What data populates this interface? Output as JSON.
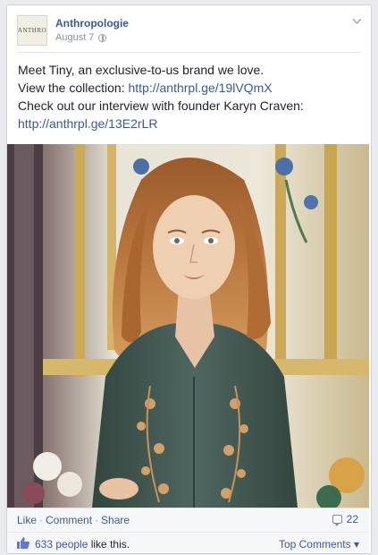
{
  "post": {
    "page_name": "Anthropologie",
    "avatar_text": "ANTHRO",
    "date": "August 7",
    "text_line_1": "Meet Tiny, an exclusive-to-us brand we love.",
    "text_line_2_prefix": "View the collection: ",
    "text_line_2_link": "http://anthrpl.ge/19lVQmX",
    "text_line_3": "Check out our interview with founder Karyn Craven:",
    "text_line_4_link": "http://anthrpl.ge/13E2rLR"
  },
  "actions": {
    "like": "Like",
    "comment": "Comment",
    "share": "Share",
    "separator": "·",
    "comment_count": "22"
  },
  "likes": {
    "count_text": "633 people",
    "suffix": " like this.",
    "top_comments": "Top Comments ▾"
  },
  "colors": {
    "link": "#3b5998",
    "text": "#1d2129",
    "muted": "#8a8f99"
  },
  "icons": [
    "globe-icon",
    "chevron-down-icon",
    "comment-icon",
    "thumbs-up-icon"
  ]
}
